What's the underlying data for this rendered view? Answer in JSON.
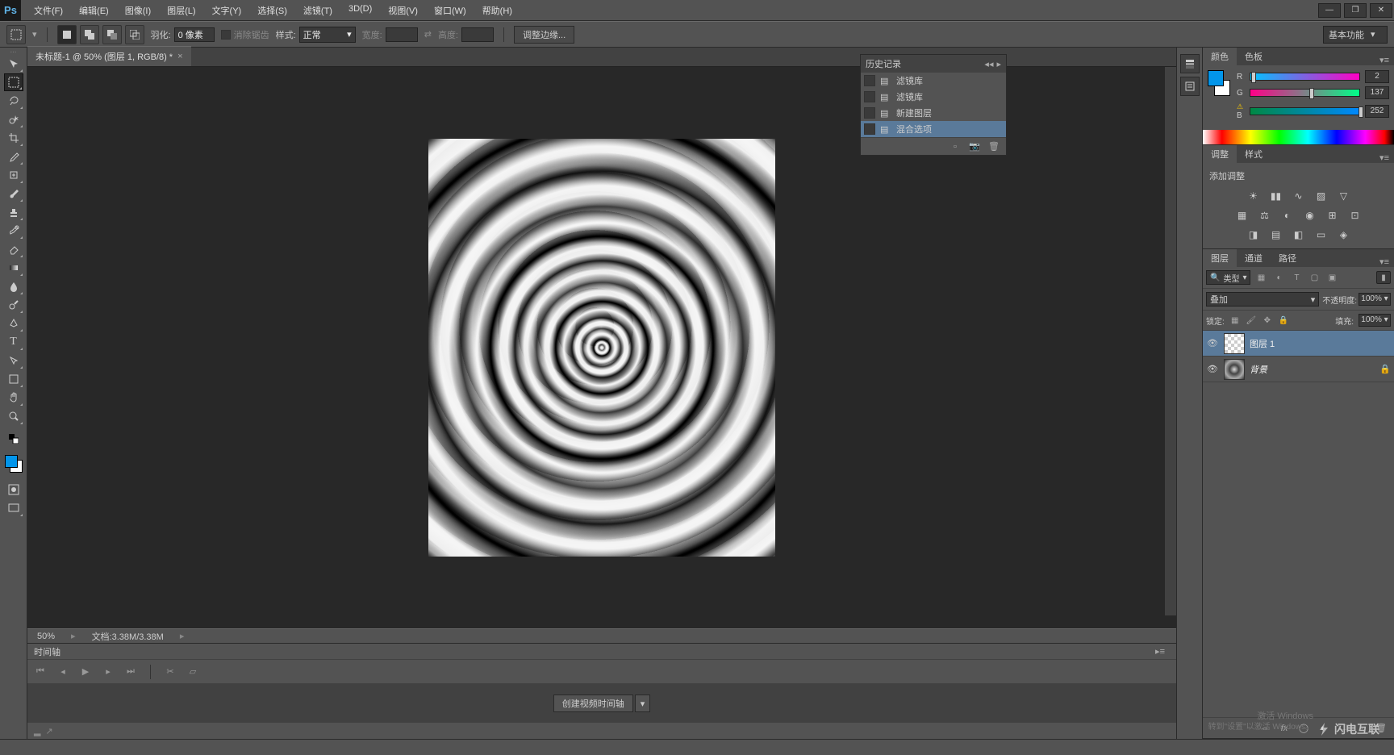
{
  "menubar": {
    "items": [
      "文件(F)",
      "编辑(E)",
      "图像(I)",
      "图层(L)",
      "文字(Y)",
      "选择(S)",
      "滤镜(T)",
      "3D(D)",
      "视图(V)",
      "窗口(W)",
      "帮助(H)"
    ]
  },
  "optionsbar": {
    "feather_label": "羽化:",
    "feather_value": "0 像素",
    "antialias_label": "消除锯齿",
    "style_label": "样式:",
    "style_value": "正常",
    "width_label": "宽度:",
    "height_label": "高度:",
    "refine_edge": "调整边缘...",
    "workspace": "基本功能"
  },
  "document": {
    "tab_title": "未标题-1 @ 50% (图层 1, RGB/8) *",
    "zoom": "50%",
    "doc_size_label": "文档:",
    "doc_size": "3.38M/3.38M"
  },
  "history": {
    "title": "历史记录",
    "items": [
      "滤镜库",
      "滤镜库",
      "新建图层",
      "混合选项"
    ],
    "selected": 3
  },
  "panels": {
    "color_tab": "颜色",
    "swatches_tab": "色板",
    "r_value": "2",
    "g_value": "137",
    "b_value": "252",
    "adjustments_tab": "调整",
    "styles_tab": "样式",
    "add_adjustment": "添加调整",
    "layers_tab": "图层",
    "channels_tab": "通道",
    "paths_tab": "路径",
    "kind_label": "类型",
    "blend_mode": "叠加",
    "opacity_label": "不透明度:",
    "opacity_value": "100%",
    "lock_label": "锁定:",
    "fill_label": "填充:",
    "fill_value": "100%",
    "layer1_name": "图层 1",
    "background_name": "背景"
  },
  "timeline": {
    "title": "时间轴",
    "create_button": "创建视频时间轴"
  },
  "watermark": "闪电互联",
  "activation": {
    "line1": "激活 Windows",
    "line2": "转到\"设置\"以激活 Windows。"
  }
}
